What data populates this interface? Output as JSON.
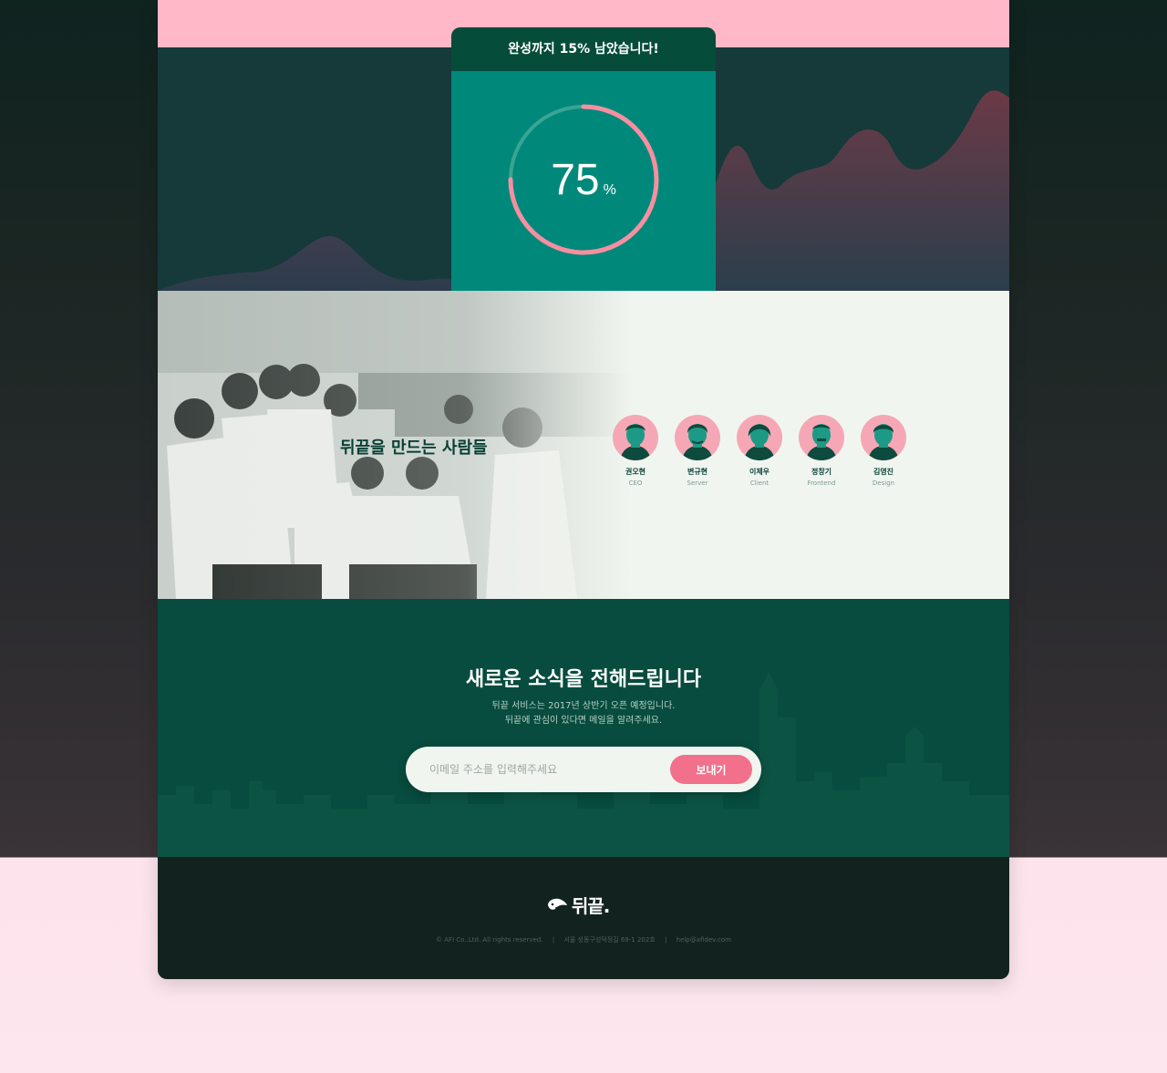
{
  "progress": {
    "header": "완성까지 15% 남았습니다!",
    "value": "75",
    "unit": "%",
    "fraction": 0.75
  },
  "team": {
    "title": "뒤끝을 만드는 사람들",
    "members": [
      {
        "name": "권오현",
        "role": "CEO"
      },
      {
        "name": "변규현",
        "role": "Server"
      },
      {
        "name": "이제우",
        "role": "Client"
      },
      {
        "name": "정창기",
        "role": "Frontend"
      },
      {
        "name": "김영진",
        "role": "Design"
      }
    ]
  },
  "newsletter": {
    "title": "새로운 소식을 전해드립니다",
    "desc_line1": "뒤끝 서비스는 2017년 상반기 오픈 예정입니다.",
    "desc_line2": "뒤끝에 관심이 있다면 메일을 알려주세요.",
    "email_placeholder": "이메일 주소를 입력해주세요",
    "send_label": "보내기"
  },
  "footer": {
    "logo_text": "뒤끝.",
    "copyright": "© AFI Co.,Ltd. All rights reserved.",
    "address": "서울 성동구성덕정길 69-1 202호",
    "email": "help@afidev.com"
  },
  "colors": {
    "pink_accent": "#f2708b",
    "teal_panel": "#00897a",
    "dark_green": "#074c3e"
  }
}
